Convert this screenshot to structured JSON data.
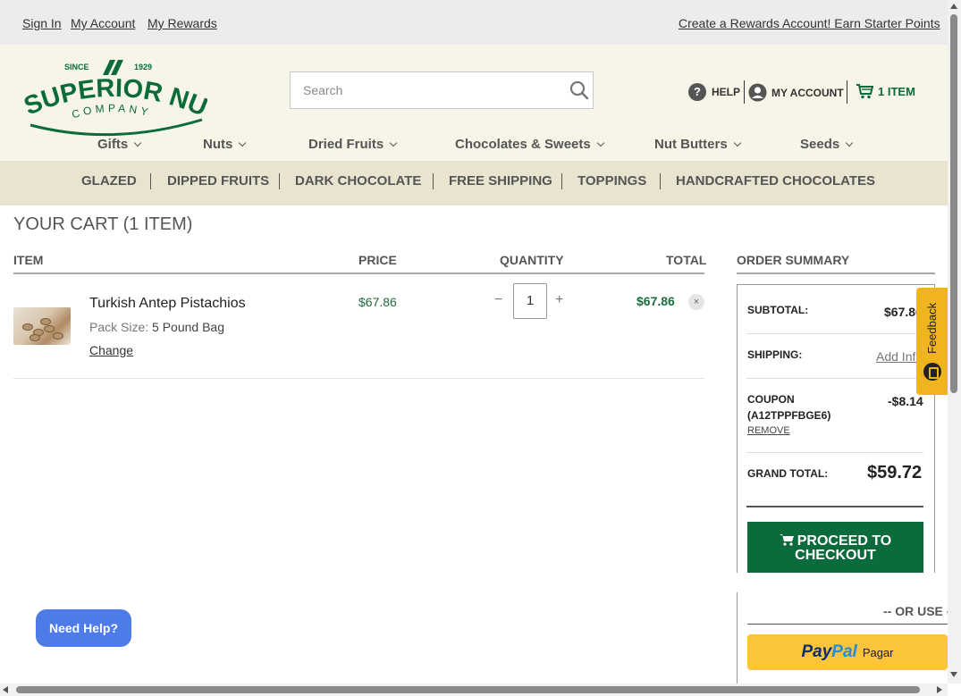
{
  "topbar": {
    "sign_in": "Sign In",
    "my_account": "My Account",
    "my_rewards": "My Rewards",
    "create_rewards": "Create a Rewards Account! Earn Starter Points"
  },
  "logo": {
    "since": "SINCE",
    "year": "1929",
    "name": "SUPERIOR NUT",
    "company": "COMPANY",
    "brand_color": "#0b6b3a"
  },
  "search": {
    "placeholder": "Search"
  },
  "util": {
    "help": "HELP",
    "help_icon": "?",
    "my_account": "MY ACCOUNT",
    "cart": "1 ITEM"
  },
  "main_nav": [
    "Gifts",
    "Nuts",
    "Dried Fruits",
    "Chocolates & Sweets",
    "Nut Butters",
    "Seeds"
  ],
  "promo_nav": [
    "GLAZED",
    "DIPPED FRUITS",
    "DARK CHOCOLATE",
    "FREE SHIPPING",
    "TOPPINGS",
    "HANDCRAFTED CHOCOLATES"
  ],
  "cart": {
    "title": "YOUR CART (1 ITEM)",
    "headers": {
      "item": "ITEM",
      "price": "PRICE",
      "quantity": "QUANTITY",
      "total": "TOTAL"
    },
    "items": [
      {
        "name": "Turkish Antep Pistachios",
        "pack_label": "Pack Size:",
        "pack_value": "5 Pound Bag",
        "change": "Change",
        "price": "$67.86",
        "qty_minus": "−",
        "quantity": "1",
        "qty_plus": "+",
        "total": "$67.86",
        "remove": "×"
      }
    ]
  },
  "summary": {
    "title": "ORDER SUMMARY",
    "subtotal_label": "SUBTOTAL:",
    "subtotal_value": "$67.86",
    "shipping_label": "SHIPPING:",
    "shipping_value": "Add Info",
    "coupon_label": "COUPON",
    "coupon_code": "(A12TPPFBGE6)",
    "coupon_remove": "REMOVE",
    "coupon_value": "-$8.14",
    "grand_label": "GRAND TOTAL:",
    "grand_value": "$59.72",
    "checkout_line1": "PROCEED TO",
    "checkout_line2": "CHECKOUT",
    "or_use": "-- OR USE --",
    "paypal_pay": "Pay",
    "paypal_pal": "Pal",
    "paypal_pagar": "Pagar"
  },
  "feedback": "Feedback",
  "need_help": "Need Help?"
}
